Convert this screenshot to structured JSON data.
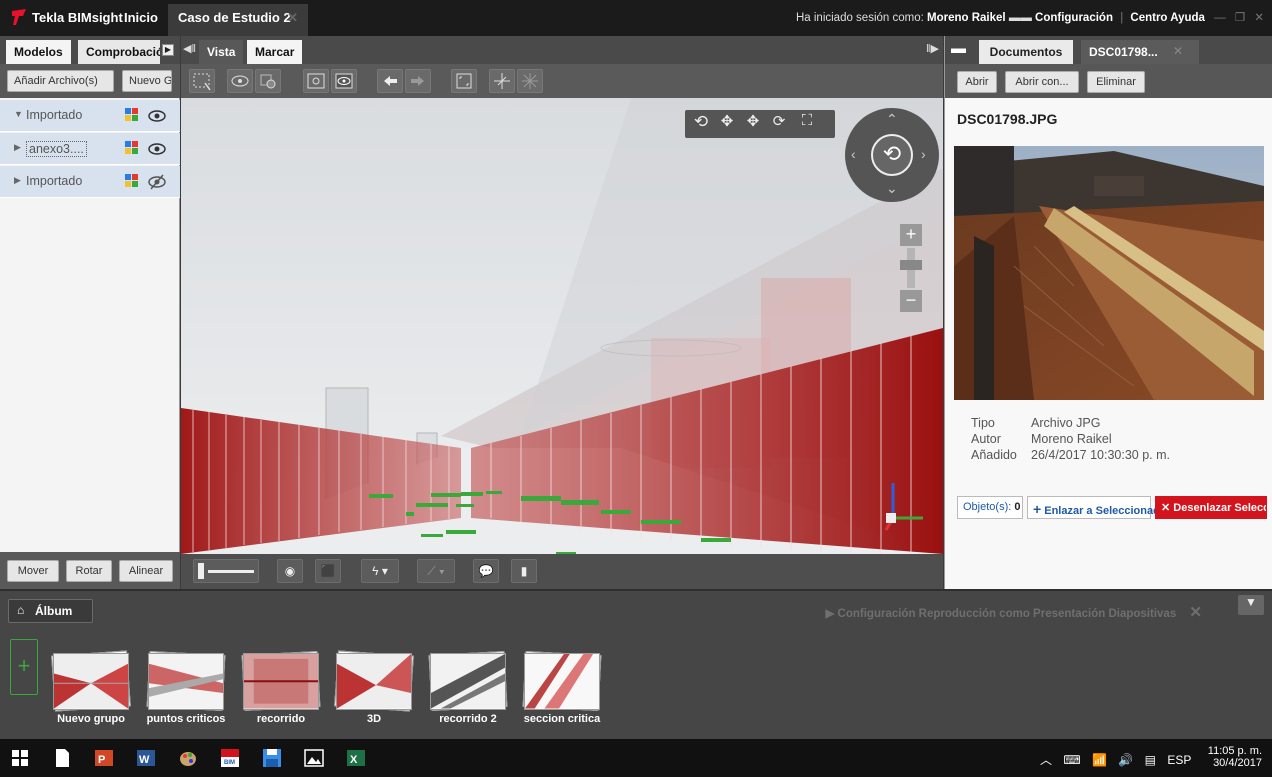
{
  "titlebar": {
    "app_name": "Tekla BIMsight",
    "home_tab": "Inicio",
    "project_tab": "Caso de Estudio 2",
    "close_glyph": "✕",
    "session_prefix": "Ha iniciado sesión como:",
    "user_name": "Moreno Raikel",
    "config": "Configuración",
    "help": "Centro Ayuda"
  },
  "left_panel": {
    "tabs": [
      "Modelos",
      "Comprobació"
    ],
    "toolbar": {
      "add_file": "Añadir Archivo(s)",
      "new": "Nuevo G"
    },
    "tree": [
      {
        "label": "Importado",
        "expanded": true,
        "visible": true
      },
      {
        "label": "anexo3....",
        "expanded": false,
        "visible": true
      },
      {
        "label": "Importado",
        "expanded": false,
        "visible": false
      }
    ],
    "bottom_buttons": [
      "Mover",
      "Rotar",
      "Alinear"
    ]
  },
  "center": {
    "tabs": [
      "Vista",
      "Marcar"
    ]
  },
  "right_panel": {
    "tabs": [
      "Documentos",
      "DSC01798..."
    ],
    "toolbar": [
      "Abrir",
      "Abrir con...",
      "Eliminar"
    ],
    "doc_title": "DSC01798.JPG",
    "meta": [
      {
        "key": "Tipo",
        "value": "Archivo JPG"
      },
      {
        "key": "Autor",
        "value": "Moreno Raikel"
      },
      {
        "key": "Añadido",
        "value": "26/4/2017 10:30:30 p. m."
      }
    ],
    "objects_label": "Objeto(s):",
    "objects_count": "0",
    "link_selected": "Enlazar a Seleccionado",
    "unlink_selected": "Desenlazar Selecc"
  },
  "album": {
    "button": "Álbum",
    "slideshow": "Configuración Reproducción como Presentación Diapositivas",
    "thumbnails": [
      "Nuevo grupo",
      "puntos criticos",
      "recorrido",
      "3D",
      "recorrido 2",
      "seccion critica"
    ]
  },
  "taskbar": {
    "lang": "ESP",
    "time": "11:05 p. m.",
    "date": "30/4/2017"
  },
  "colors": {
    "accent_red": "#c8102e",
    "link_blue": "#1e5aa8",
    "model_red": "#a01818"
  }
}
